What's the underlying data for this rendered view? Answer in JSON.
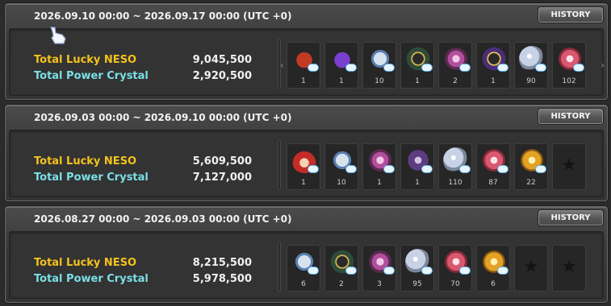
{
  "panels": [
    {
      "period": "2026.09.10 00:00 ~ 2026.09.17 00:00 (UTC +0)",
      "history_label": "HISTORY",
      "neso_label": "Total Lucky NESO",
      "neso_value": "9,045,500",
      "crystal_label": "Total Power Crystal",
      "crystal_value": "2,920,500",
      "items": [
        {
          "icon": "boots-icon",
          "qty": "1"
        },
        {
          "icon": "wizard-hat-icon",
          "qty": "1"
        },
        {
          "icon": "lock-icon",
          "qty": "10"
        },
        {
          "icon": "ring-green-icon",
          "qty": "1"
        },
        {
          "icon": "coin-pink-icon",
          "qty": "2"
        },
        {
          "icon": "ring-purple-icon",
          "qty": "1"
        },
        {
          "icon": "orb-silver-icon",
          "qty": "90"
        },
        {
          "icon": "orb-red-icon",
          "qty": "102"
        }
      ]
    },
    {
      "period": "2026.09.03 00:00 ~ 2026.09.10 00:00 (UTC +0)",
      "history_label": "HISTORY",
      "neso_label": "Total Lucky NESO",
      "neso_value": "5,609,500",
      "crystal_label": "Total Power Crystal",
      "crystal_value": "7,127,000",
      "items": [
        {
          "icon": "red-hair-icon",
          "qty": "1"
        },
        {
          "icon": "lock-icon",
          "qty": "10"
        },
        {
          "icon": "coin-pink-icon",
          "qty": "1"
        },
        {
          "icon": "wings-icon",
          "qty": "1"
        },
        {
          "icon": "orb-silver-icon",
          "qty": "110"
        },
        {
          "icon": "orb-red-icon",
          "qty": "87"
        },
        {
          "icon": "orb-gold-icon",
          "qty": "22"
        },
        {
          "icon": "empty-slot-icon",
          "qty": ""
        }
      ]
    },
    {
      "period": "2026.08.27 00:00 ~ 2026.09.03 00:00 (UTC +0)",
      "history_label": "HISTORY",
      "neso_label": "Total Lucky NESO",
      "neso_value": "8,215,500",
      "crystal_label": "Total Power Crystal",
      "crystal_value": "5,978,500",
      "items": [
        {
          "icon": "lock-icon",
          "qty": "6"
        },
        {
          "icon": "ring-green-icon",
          "qty": "2"
        },
        {
          "icon": "coin-pink-icon",
          "qty": "3"
        },
        {
          "icon": "orb-silver-icon",
          "qty": "95"
        },
        {
          "icon": "orb-red-icon",
          "qty": "70"
        },
        {
          "icon": "orb-gold-icon",
          "qty": "6"
        },
        {
          "icon": "empty-slot-icon",
          "qty": ""
        },
        {
          "icon": "empty-slot-icon",
          "qty": ""
        }
      ]
    }
  ]
}
